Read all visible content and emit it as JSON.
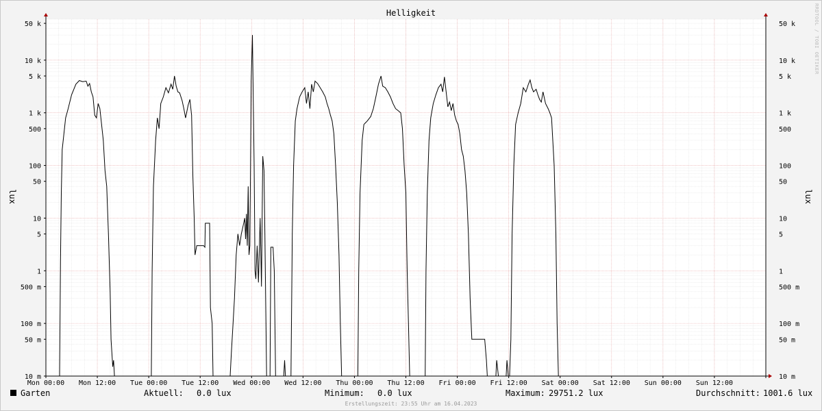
{
  "chart_data": {
    "type": "line",
    "title": "Helligkeit",
    "ylabel": "lux",
    "ylabel_right": "lux",
    "yscale": "log",
    "ylim": [
      0.01,
      60000
    ],
    "y_ticks": [
      {
        "value": 0.01,
        "label": "10 m"
      },
      {
        "value": 0.05,
        "label": "50 m"
      },
      {
        "value": 0.1,
        "label": "100 m"
      },
      {
        "value": 0.5,
        "label": "500 m"
      },
      {
        "value": 1,
        "label": "1"
      },
      {
        "value": 5,
        "label": "5"
      },
      {
        "value": 10,
        "label": "10"
      },
      {
        "value": 50,
        "label": "50"
      },
      {
        "value": 100,
        "label": "100"
      },
      {
        "value": 500,
        "label": "500"
      },
      {
        "value": 1000,
        "label": "1 k"
      },
      {
        "value": 5000,
        "label": "5 k"
      },
      {
        "value": 10000,
        "label": "10 k"
      },
      {
        "value": 50000,
        "label": "50 k"
      }
    ],
    "x_unit": "hours since Mon 00:00",
    "xlim": [
      0,
      168
    ],
    "x_ticks": [
      {
        "value": 0,
        "label": "Mon 00:00"
      },
      {
        "value": 12,
        "label": "Mon 12:00"
      },
      {
        "value": 24,
        "label": "Tue 00:00"
      },
      {
        "value": 36,
        "label": "Tue 12:00"
      },
      {
        "value": 48,
        "label": "Wed 00:00"
      },
      {
        "value": 60,
        "label": "Wed 12:00"
      },
      {
        "value": 72,
        "label": "Thu 00:00"
      },
      {
        "value": 84,
        "label": "Thu 12:00"
      },
      {
        "value": 96,
        "label": "Fri 00:00"
      },
      {
        "value": 108,
        "label": "Fri 12:00"
      },
      {
        "value": 120,
        "label": "Sat 00:00"
      },
      {
        "value": 132,
        "label": "Sat 12:00"
      },
      {
        "value": 144,
        "label": "Sun 00:00"
      },
      {
        "value": 156,
        "label": "Sun 12:00"
      }
    ],
    "grid": true,
    "legend": "bottom",
    "series": [
      {
        "name": "Garten",
        "color": "#000000",
        "points": [
          [
            0,
            0.01
          ],
          [
            3.2,
            0.01
          ],
          [
            3.4,
            1.5
          ],
          [
            3.6,
            30
          ],
          [
            3.8,
            200
          ],
          [
            4.2,
            400
          ],
          [
            4.6,
            800
          ],
          [
            5.2,
            1200
          ],
          [
            6,
            2200
          ],
          [
            7,
            3500
          ],
          [
            7.8,
            4100
          ],
          [
            8.6,
            3900
          ],
          [
            9.4,
            4000
          ],
          [
            9.8,
            3200
          ],
          [
            10.2,
            3600
          ],
          [
            10.6,
            2500
          ],
          [
            11,
            2000
          ],
          [
            11.4,
            900
          ],
          [
            11.8,
            800
          ],
          [
            12.2,
            1500
          ],
          [
            12.6,
            1200
          ],
          [
            13,
            600
          ],
          [
            13.4,
            300
          ],
          [
            13.8,
            80
          ],
          [
            14.2,
            40
          ],
          [
            14.6,
            5
          ],
          [
            15,
            0.4
          ],
          [
            15.2,
            0.05
          ],
          [
            15.6,
            0.015
          ],
          [
            15.8,
            0.02
          ],
          [
            16,
            0.01
          ],
          [
            24.6,
            0.01
          ],
          [
            24.8,
            1
          ],
          [
            25.1,
            40
          ],
          [
            25.6,
            300
          ],
          [
            26,
            800
          ],
          [
            26.4,
            500
          ],
          [
            26.8,
            1500
          ],
          [
            27.4,
            2000
          ],
          [
            28,
            3000
          ],
          [
            28.6,
            2400
          ],
          [
            29.2,
            3500
          ],
          [
            29.6,
            2800
          ],
          [
            30,
            5000
          ],
          [
            30.4,
            3200
          ],
          [
            30.8,
            2500
          ],
          [
            31.2,
            2400
          ],
          [
            31.8,
            1700
          ],
          [
            32.2,
            1200
          ],
          [
            32.6,
            800
          ],
          [
            33.2,
            1400
          ],
          [
            33.6,
            1800
          ],
          [
            34,
            900
          ],
          [
            34.3,
            60
          ],
          [
            34.6,
            10
          ],
          [
            34.8,
            2
          ],
          [
            35.2,
            3
          ],
          [
            35.8,
            3
          ],
          [
            36.4,
            3
          ],
          [
            36.8,
            3
          ],
          [
            37.1,
            2.8
          ],
          [
            37.2,
            8
          ],
          [
            37.8,
            8
          ],
          [
            38.2,
            8
          ],
          [
            38.4,
            0.2
          ],
          [
            38.8,
            0.1
          ],
          [
            39,
            0.01
          ],
          [
            43,
            0.01
          ],
          [
            43.3,
            0.03
          ],
          [
            43.6,
            0.08
          ],
          [
            44,
            0.3
          ],
          [
            44.4,
            2
          ],
          [
            44.8,
            5
          ],
          [
            45.2,
            3
          ],
          [
            45.6,
            5
          ],
          [
            46,
            7
          ],
          [
            46.4,
            10
          ],
          [
            46.6,
            4
          ],
          [
            46.8,
            12
          ],
          [
            47,
            3
          ],
          [
            47.2,
            40
          ],
          [
            47.4,
            2
          ],
          [
            47.6,
            3
          ],
          [
            47.9,
            4000
          ],
          [
            48.2,
            30000
          ],
          [
            48.6,
            100
          ],
          [
            48.8,
            1
          ],
          [
            49,
            0.7
          ],
          [
            49.3,
            3
          ],
          [
            49.6,
            0.6
          ],
          [
            50,
            10
          ],
          [
            50.3,
            0.5
          ],
          [
            50.6,
            150
          ],
          [
            50.9,
            80
          ],
          [
            51.1,
            5
          ],
          [
            51.5,
            0.01
          ],
          [
            52.3,
            0.01
          ],
          [
            52.5,
            2.8
          ],
          [
            53,
            2.8
          ],
          [
            53.3,
            1
          ],
          [
            53.6,
            0.01
          ],
          [
            55.5,
            0.01
          ],
          [
            55.7,
            0.02
          ],
          [
            55.9,
            0.01
          ],
          [
            57.2,
            0.01
          ],
          [
            57.5,
            5
          ],
          [
            57.8,
            100
          ],
          [
            58.2,
            700
          ],
          [
            58.6,
            1200
          ],
          [
            59.2,
            2000
          ],
          [
            59.8,
            2500
          ],
          [
            60.4,
            3000
          ],
          [
            60.8,
            1500
          ],
          [
            61.2,
            2500
          ],
          [
            61.6,
            1200
          ],
          [
            62,
            3500
          ],
          [
            62.4,
            2500
          ],
          [
            62.8,
            4000
          ],
          [
            63.4,
            3600
          ],
          [
            64,
            3000
          ],
          [
            64.6,
            2500
          ],
          [
            65.2,
            2000
          ],
          [
            65.6,
            1500
          ],
          [
            66,
            1200
          ],
          [
            66.4,
            900
          ],
          [
            66.8,
            700
          ],
          [
            67.2,
            400
          ],
          [
            67.6,
            100
          ],
          [
            68,
            20
          ],
          [
            68.4,
            2
          ],
          [
            68.7,
            0.1
          ],
          [
            69,
            0.01
          ],
          [
            72.8,
            0.01
          ],
          [
            73,
            1
          ],
          [
            73.3,
            30
          ],
          [
            73.8,
            300
          ],
          [
            74.2,
            600
          ],
          [
            74.6,
            650
          ],
          [
            75,
            700
          ],
          [
            75.8,
            850
          ],
          [
            76.4,
            1200
          ],
          [
            77,
            2000
          ],
          [
            77.6,
            3500
          ],
          [
            78.2,
            5000
          ],
          [
            78.6,
            3200
          ],
          [
            79.2,
            3000
          ],
          [
            79.8,
            2500
          ],
          [
            80.4,
            2000
          ],
          [
            81,
            1500
          ],
          [
            81.6,
            1200
          ],
          [
            82.2,
            1100
          ],
          [
            82.8,
            1000
          ],
          [
            83.2,
            500
          ],
          [
            83.6,
            100
          ],
          [
            84,
            30
          ],
          [
            84.3,
            1
          ],
          [
            84.6,
            0.1
          ],
          [
            84.9,
            0.01
          ],
          [
            88.5,
            0.01
          ],
          [
            88.7,
            1
          ],
          [
            89,
            30
          ],
          [
            89.4,
            300
          ],
          [
            89.8,
            800
          ],
          [
            90.4,
            1500
          ],
          [
            91,
            2200
          ],
          [
            91.6,
            3000
          ],
          [
            92.2,
            3500
          ],
          [
            92.6,
            2500
          ],
          [
            93,
            4800
          ],
          [
            93.4,
            2500
          ],
          [
            93.8,
            1300
          ],
          [
            94.2,
            1600
          ],
          [
            94.6,
            1100
          ],
          [
            95,
            1500
          ],
          [
            95.4,
            900
          ],
          [
            95.8,
            700
          ],
          [
            96.2,
            600
          ],
          [
            96.6,
            400
          ],
          [
            97,
            200
          ],
          [
            97.4,
            150
          ],
          [
            97.8,
            80
          ],
          [
            98.2,
            30
          ],
          [
            98.6,
            5
          ],
          [
            99,
            0.3
          ],
          [
            99.4,
            0.05
          ],
          [
            99.6,
            0.05
          ],
          [
            102,
            0.05
          ],
          [
            102.4,
            0.05
          ],
          [
            102.8,
            0.02
          ],
          [
            103,
            0.01
          ],
          [
            105,
            0.01
          ],
          [
            105.2,
            0.02
          ],
          [
            105.6,
            0.01
          ],
          [
            107.4,
            0.01
          ],
          [
            107.6,
            0.02
          ],
          [
            107.9,
            0.01
          ],
          [
            108.2,
            0.01
          ],
          [
            108.5,
            0.05
          ],
          [
            108.8,
            5
          ],
          [
            109.2,
            100
          ],
          [
            109.6,
            600
          ],
          [
            110.2,
            1000
          ],
          [
            110.8,
            1500
          ],
          [
            111.4,
            3000
          ],
          [
            112,
            2500
          ],
          [
            112.6,
            3500
          ],
          [
            113,
            4200
          ],
          [
            113.4,
            3000
          ],
          [
            113.8,
            2500
          ],
          [
            114.4,
            2800
          ],
          [
            114.8,
            2200
          ],
          [
            115.2,
            1800
          ],
          [
            115.6,
            1600
          ],
          [
            116,
            2500
          ],
          [
            116.6,
            1500
          ],
          [
            117.2,
            1200
          ],
          [
            117.6,
            1000
          ],
          [
            118,
            800
          ],
          [
            118.6,
            100
          ],
          [
            119,
            5
          ],
          [
            119.3,
            0.1
          ],
          [
            119.6,
            0.01
          ],
          [
            120,
            0.01
          ]
        ]
      }
    ]
  },
  "legend": {
    "series_name": "Garten",
    "current_label": "Aktuell:",
    "current_value": "0.0 lux",
    "minimum_label": "Minimum:",
    "minimum_value": "0.0 lux",
    "maximum_label": "Maximum:",
    "maximum_value": "29751.2 lux",
    "average_label": "Durchschnitt:",
    "average_value": "1001.6 lux"
  },
  "footer": "Erstellungszeit: 23:55 Uhr am 16.04.2023",
  "watermark": "RRDTOOL / TOBI OETIKER",
  "colors": {
    "background": "#f3f3f3",
    "canvas": "#ffffff",
    "grid_minor": "#dddddd",
    "grid_major": "#e8a0a0",
    "axis": "#000000",
    "arrow": "#aa0000",
    "line": "#000000"
  }
}
